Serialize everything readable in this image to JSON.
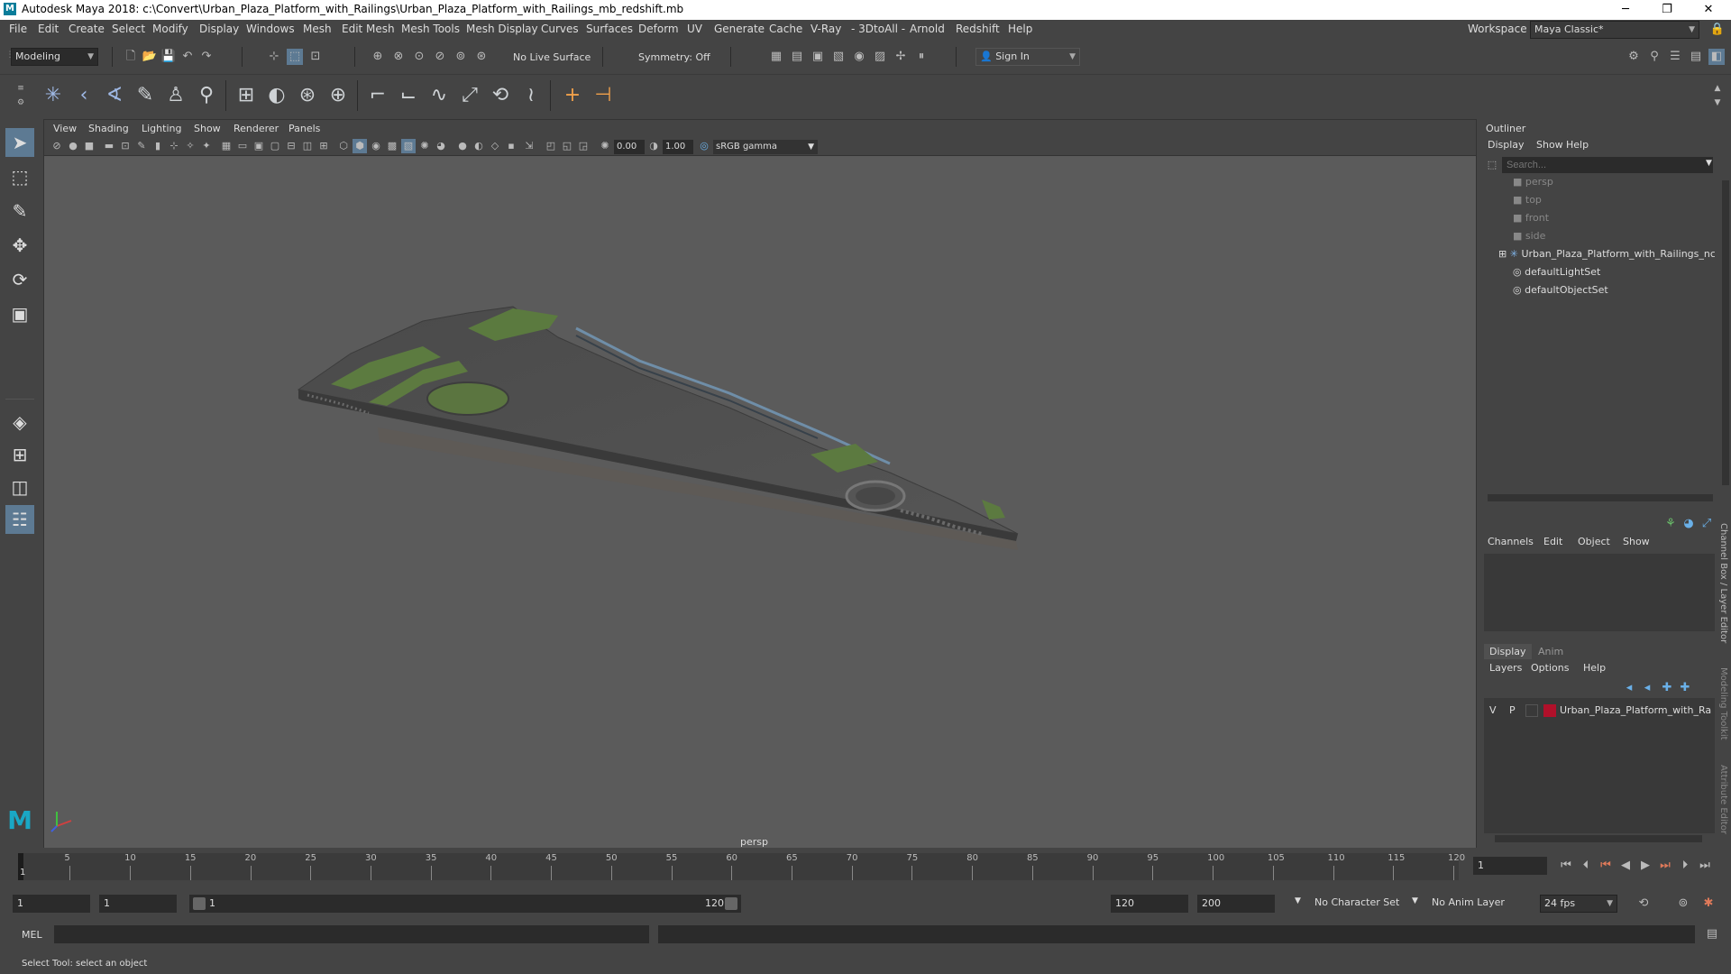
{
  "window": {
    "title": "Autodesk Maya 2018: c:\\Convert\\Urban_Plaza_Platform_with_Railings\\Urban_Plaza_Platform_with_Railings_mb_redshift.mb",
    "minimize": "─",
    "maximize": "❐",
    "close": "✕"
  },
  "menu": [
    "File",
    "Edit",
    "Create",
    "Select",
    "Modify",
    "Display",
    "Windows",
    "Mesh",
    "Edit Mesh",
    "Mesh Tools",
    "Mesh Display",
    "Curves",
    "Surfaces",
    "Deform",
    "UV",
    "Generate",
    "Cache",
    "V-Ray",
    "- 3DtoAll -",
    "Arnold",
    "Redshift",
    "Help"
  ],
  "workspace": {
    "label": "Workspace :",
    "value": "Maya Classic*"
  },
  "status": {
    "mode": "Modeling",
    "live_surface": "No Live Surface",
    "symmetry": "Symmetry: Off",
    "sign_in": "Sign In"
  },
  "viewport": {
    "menus": [
      "View",
      "Shading",
      "Lighting",
      "Show",
      "Renderer",
      "Panels"
    ],
    "exposure": "0.00",
    "gamma": "1.00",
    "color_space": "sRGB gamma",
    "camera": "persp"
  },
  "outliner": {
    "title": "Outliner",
    "menus": [
      "Display",
      "Show",
      "Help"
    ],
    "search_placeholder": "Search...",
    "items": [
      "persp",
      "top",
      "front",
      "side",
      "Urban_Plaza_Platform_with_Railings_ncl",
      "defaultLightSet",
      "defaultObjectSet"
    ]
  },
  "channel_box": {
    "menus": [
      "Channels",
      "Edit",
      "Object",
      "Show"
    ]
  },
  "layer_editor": {
    "tabs": [
      "Display",
      "Anim"
    ],
    "menus": [
      "Layers",
      "Options",
      "Help"
    ],
    "layer": {
      "v": "V",
      "p": "P",
      "name": "Urban_Plaza_Platform_with_Ra",
      "color": "#b0102a"
    }
  },
  "side_tabs": [
    "Channel Box / Layer Editor",
    "Modeling Toolkit",
    "Attribute Editor"
  ],
  "timeline": {
    "ticks": [
      "5",
      "10",
      "15",
      "20",
      "25",
      "30",
      "35",
      "40",
      "45",
      "50",
      "55",
      "60",
      "65",
      "70",
      "75",
      "80",
      "85",
      "90",
      "95",
      "100",
      "105",
      "110",
      "115",
      "120"
    ],
    "start_marker": "1",
    "current_frame": "1"
  },
  "range": {
    "start": "1",
    "playback_start": "1",
    "slider_start": "1",
    "slider_end": "120",
    "playback_end": "120",
    "end": "200",
    "character_set": "No Character Set",
    "anim_layer": "No Anim Layer",
    "fps": "24 fps"
  },
  "command": {
    "label": "MEL"
  },
  "help_line": "Select Tool: select an object"
}
